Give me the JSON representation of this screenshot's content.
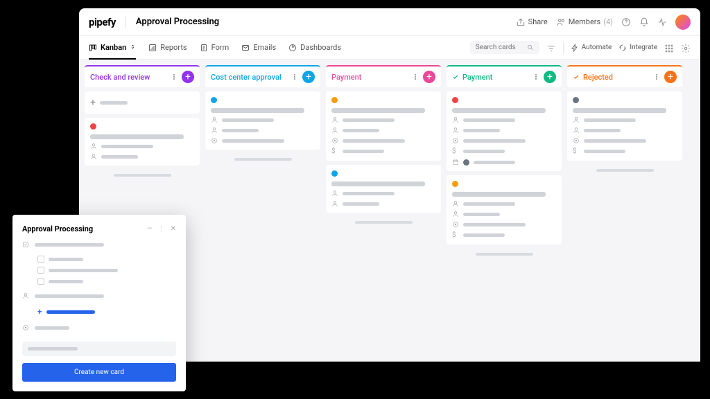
{
  "header": {
    "logo": "pipefy",
    "title": "Approval Processing",
    "share": "Share",
    "members_label": "Members",
    "members_count": "(4)"
  },
  "views": {
    "kanban": "Kanban",
    "reports": "Reports",
    "form": "Form",
    "emails": "Emails",
    "dashboards": "Dashboards",
    "search_placeholder": "Search cards",
    "automate": "Automate",
    "integrate": "Integrate"
  },
  "columns": [
    {
      "name": "Check and review",
      "color": "c1"
    },
    {
      "name": "Cost center approval",
      "color": "c2"
    },
    {
      "name": "Payment",
      "color": "c3"
    },
    {
      "name": "Payment",
      "color": "c4",
      "approved": true
    },
    {
      "name": "Rejected",
      "color": "c5",
      "approved": true
    }
  ],
  "modal": {
    "title": "Approval Processing",
    "submit": "Create new card"
  }
}
